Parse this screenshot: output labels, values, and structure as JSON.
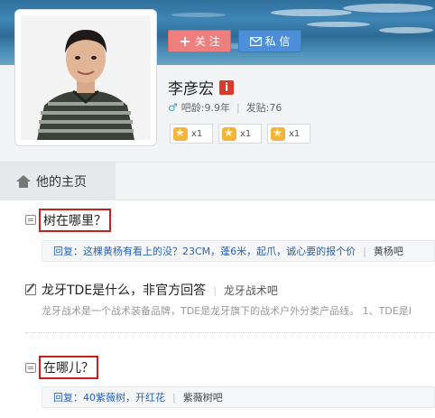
{
  "profile": {
    "follow_label": "关 注",
    "message_label": "私 信",
    "name": "李彦宏",
    "badge": "i",
    "gender_symbol": "♂",
    "age_label": "吧龄:9.9年",
    "posts_label": "发贴:76",
    "medals": [
      {
        "count": "x1"
      },
      {
        "count": "x1"
      },
      {
        "count": "x1"
      }
    ]
  },
  "tabs": {
    "home_label": "他的主页"
  },
  "feed": [
    {
      "title": "树在哪里？",
      "reply_label": "回复：",
      "reply_text": "这棵黄杨有看上的没？23CM，蓬6米，起爪，诚心要的报个价",
      "forum": "黄杨吧"
    },
    {
      "title": "龙牙TDE是什么，非官方回答",
      "forum": "龙牙战术吧",
      "abstract": "龙牙战术是一个战术装备品牌，TDE是龙牙旗下的战术户外分类产品线。 1、TDE是Ⅰ"
    },
    {
      "title": "在哪儿？",
      "reply_label": "回复：",
      "reply_text": "40紫薇树，开红花",
      "forum": "紫薇树吧"
    }
  ],
  "colors": {
    "highlight_box": "#c8201d",
    "follow_button": "#ef7f7f",
    "message_button": "#4c8fd8",
    "link_blue": "#2d64b3"
  }
}
